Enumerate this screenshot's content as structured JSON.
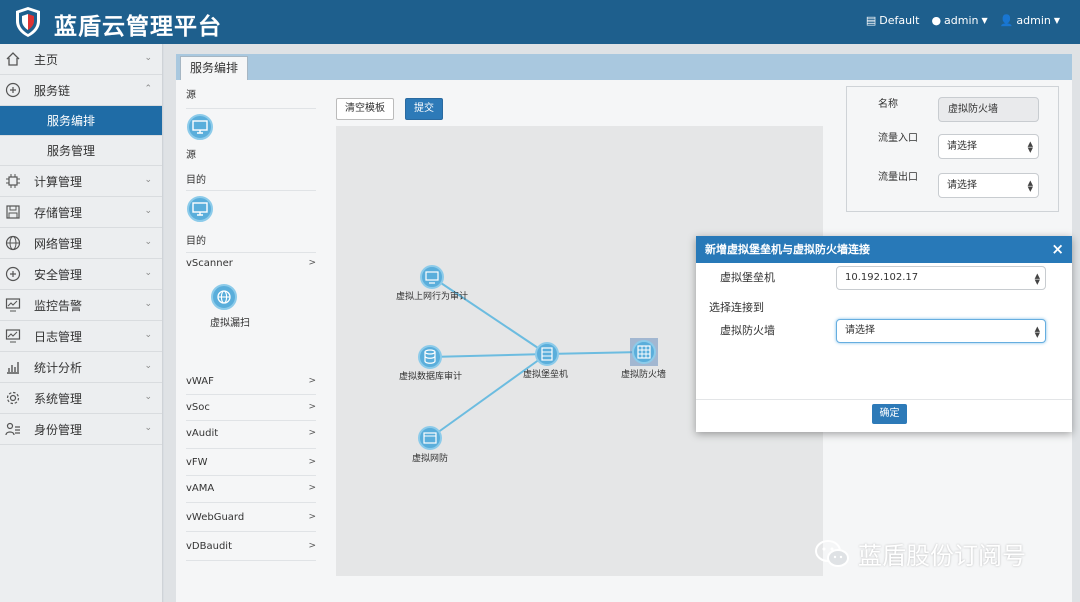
{
  "header": {
    "title": "蓝盾云管理平台",
    "nav": [
      {
        "label": "Default",
        "icon": "table-icon"
      },
      {
        "label": "admin",
        "icon": "dot-icon"
      },
      {
        "label": "admin",
        "icon": "user-icon"
      }
    ]
  },
  "sidebar": {
    "items": [
      {
        "label": "主页",
        "icon": "home-icon"
      },
      {
        "label": "服务链",
        "icon": "plus-circle-icon",
        "expanded": true,
        "children": [
          {
            "label": "服务编排",
            "active": true
          },
          {
            "label": "服务管理"
          }
        ]
      },
      {
        "label": "计算管理",
        "icon": "chip-icon"
      },
      {
        "label": "存储管理",
        "icon": "floppy-icon"
      },
      {
        "label": "网络管理",
        "icon": "globe-icon"
      },
      {
        "label": "安全管理",
        "icon": "plus-circle-icon"
      },
      {
        "label": "监控告警",
        "icon": "monitor-chart-icon"
      },
      {
        "label": "日志管理",
        "icon": "monitor-chart-icon"
      },
      {
        "label": "统计分析",
        "icon": "bar-chart-icon"
      },
      {
        "label": "系统管理",
        "icon": "gear-icon"
      },
      {
        "label": "身份管理",
        "icon": "id-icon"
      }
    ]
  },
  "tab": {
    "label": "服务编排"
  },
  "palette": {
    "source_header": "源",
    "source_icon_label": "源",
    "dest_header": "目的",
    "dest_icon_label": "目的",
    "vscanner": "vScanner",
    "vscanner_item": "虚拟漏扫",
    "groups": [
      "vWAF",
      "vSoc",
      "vAudit",
      "vFW",
      "vAMA",
      "vWebGuard",
      "vDBaudit"
    ],
    "chevron": ">"
  },
  "toolbar": {
    "clear_label": "清空模板",
    "submit_label": "提交"
  },
  "canvas": {
    "nodes": [
      {
        "label": "虚拟上网行为审计",
        "icon": "monitor-icon"
      },
      {
        "label": "虚拟数据库审计",
        "icon": "database-icon"
      },
      {
        "label": "虚拟堡垒机",
        "icon": "server-icon"
      },
      {
        "label": "虚拟防火墙",
        "icon": "firewall-icon"
      },
      {
        "label": "虚拟网防",
        "icon": "window-icon"
      }
    ]
  },
  "props": {
    "name_label": "名称",
    "name_value": "虚拟防火墙",
    "inflow_label": "流量入口",
    "inflow_value": "请选择",
    "outflow_label": "流量出口",
    "outflow_value": "请选择"
  },
  "modal": {
    "title": "新增虚拟堡垒机与虚拟防火墙连接",
    "close": "×",
    "field1_label": "虚拟堡垒机",
    "field1_value": "10.192.102.17",
    "connect_label": "选择连接到",
    "field2_label": "虚拟防火墙",
    "field2_value": "请选择",
    "ok_label": "确定"
  },
  "watermark": {
    "text": "蓝盾股份订阅号"
  },
  "colors": {
    "header": "#1e5f8d",
    "accent": "#2879b8",
    "node": "#5aaedb",
    "edge": "#6cbce0"
  }
}
